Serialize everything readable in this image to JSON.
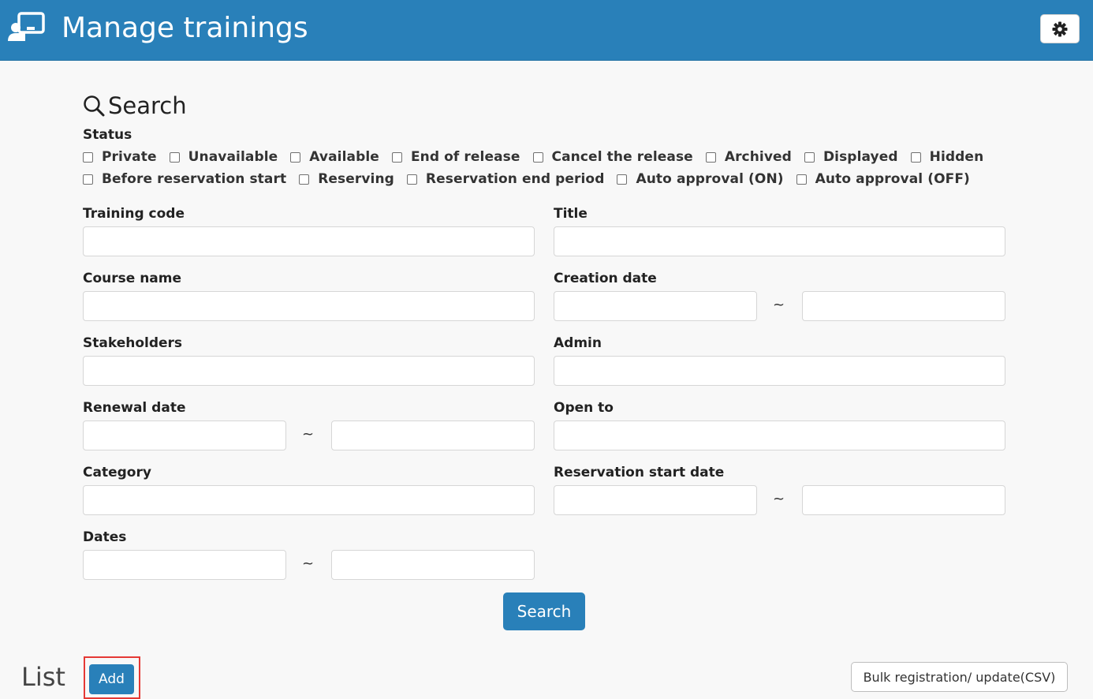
{
  "header": {
    "title": "Manage trainings",
    "icon": "teacher-board-icon",
    "settings_icon": "gear-icon"
  },
  "search": {
    "heading": "Search",
    "heading_icon": "search-icon",
    "status_label": "Status",
    "status_row1": [
      "Private",
      "Unavailable",
      "Available",
      "End of release",
      "Cancel the release",
      "Archived",
      "Displayed",
      "Hidden"
    ],
    "status_row2": [
      "Before reservation start",
      "Reserving",
      "Reservation end period",
      "Auto approval (ON)",
      "Auto approval (OFF)"
    ],
    "fields": {
      "training_code": "Training code",
      "title": "Title",
      "course_name": "Course name",
      "creation_date": "Creation date",
      "stakeholders": "Stakeholders",
      "admin": "Admin",
      "renewal_date": "Renewal date",
      "open_to": "Open to",
      "category": "Category",
      "reservation_start_date": "Reservation start date",
      "dates": "Dates"
    },
    "range_separator": "~",
    "button": "Search"
  },
  "list": {
    "title": "List",
    "add_button": "Add",
    "bulk_button": "Bulk registration/ update(CSV)"
  }
}
